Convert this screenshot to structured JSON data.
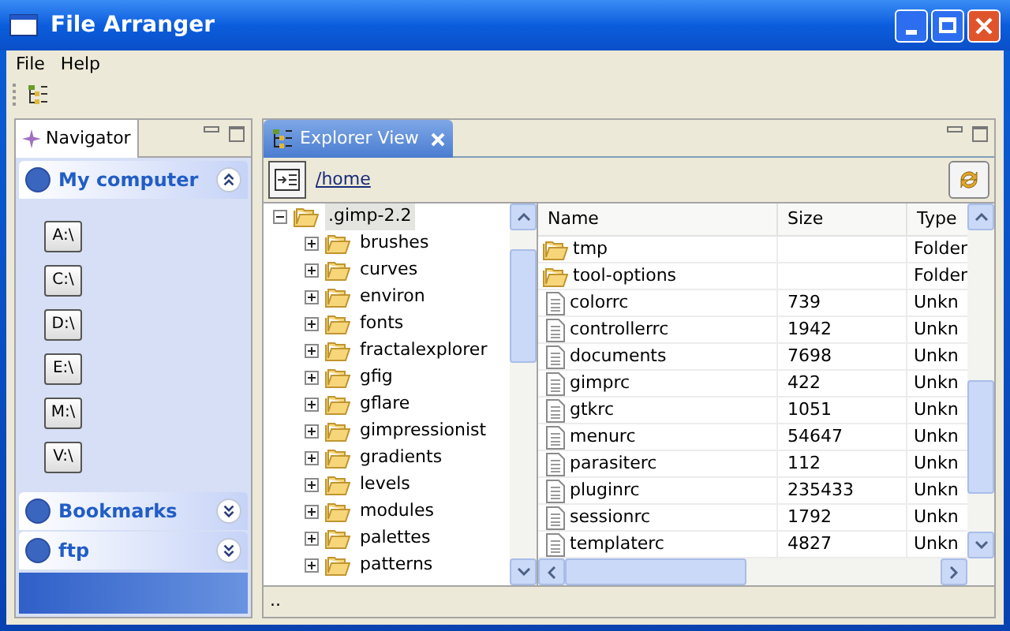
{
  "window": {
    "title": "File Arranger"
  },
  "menu": [
    "File",
    "Help"
  ],
  "navigator": {
    "tab": "Navigator",
    "sections": [
      {
        "label": "My computer",
        "expanded": true,
        "drives": [
          "A:\\",
          "C:\\",
          "D:\\",
          "E:\\",
          "M:\\",
          "V:\\"
        ]
      },
      {
        "label": "Bookmarks",
        "expanded": false
      },
      {
        "label": "ftp",
        "expanded": false
      }
    ]
  },
  "explorer": {
    "tab": "Explorer View",
    "path": "/home",
    "tree": [
      {
        "label": ".gimp-2.2",
        "expanded": true,
        "selected": true,
        "children": [
          {
            "label": "brushes",
            "expanded": false,
            "selected": false
          },
          {
            "label": "curves",
            "expanded": false,
            "selected": false
          },
          {
            "label": "environ",
            "expanded": false,
            "selected": false
          },
          {
            "label": "fonts",
            "expanded": false,
            "selected": false
          },
          {
            "label": "fractalexplorer",
            "expanded": false,
            "selected": false
          },
          {
            "label": "gfig",
            "expanded": false,
            "selected": false
          },
          {
            "label": "gflare",
            "expanded": false,
            "selected": false
          },
          {
            "label": "gimpressionist",
            "expanded": false,
            "selected": false
          },
          {
            "label": "gradients",
            "expanded": false,
            "selected": false
          },
          {
            "label": "levels",
            "expanded": false,
            "selected": false
          },
          {
            "label": "modules",
            "expanded": false,
            "selected": false
          },
          {
            "label": "palettes",
            "expanded": false,
            "selected": false
          },
          {
            "label": "patterns",
            "expanded": false,
            "selected": false
          }
        ]
      }
    ],
    "table": {
      "columns": [
        "Name",
        "Size",
        "Type"
      ],
      "rows": [
        {
          "kind": "folder",
          "name": "tmp",
          "size": "",
          "type": "Folder"
        },
        {
          "kind": "folder",
          "name": "tool-options",
          "size": "",
          "type": "Folder"
        },
        {
          "kind": "file",
          "name": "colorrc",
          "size": "739",
          "type": "Unkn"
        },
        {
          "kind": "file",
          "name": "controllerrc",
          "size": "1942",
          "type": "Unkn"
        },
        {
          "kind": "file",
          "name": "documents",
          "size": "7698",
          "type": "Unkn"
        },
        {
          "kind": "file",
          "name": "gimprc",
          "size": "422",
          "type": "Unkn"
        },
        {
          "kind": "file",
          "name": "gtkrc",
          "size": "1051",
          "type": "Unkn"
        },
        {
          "kind": "file",
          "name": "menurc",
          "size": "54647",
          "type": "Unkn"
        },
        {
          "kind": "file",
          "name": "parasiterc",
          "size": "112",
          "type": "Unkn"
        },
        {
          "kind": "file",
          "name": "pluginrc",
          "size": "235433",
          "type": "Unkn"
        },
        {
          "kind": "file",
          "name": "sessionrc",
          "size": "1792",
          "type": "Unkn"
        },
        {
          "kind": "file",
          "name": "templaterc",
          "size": "4827",
          "type": "Unkn"
        }
      ]
    },
    "status": ".."
  }
}
